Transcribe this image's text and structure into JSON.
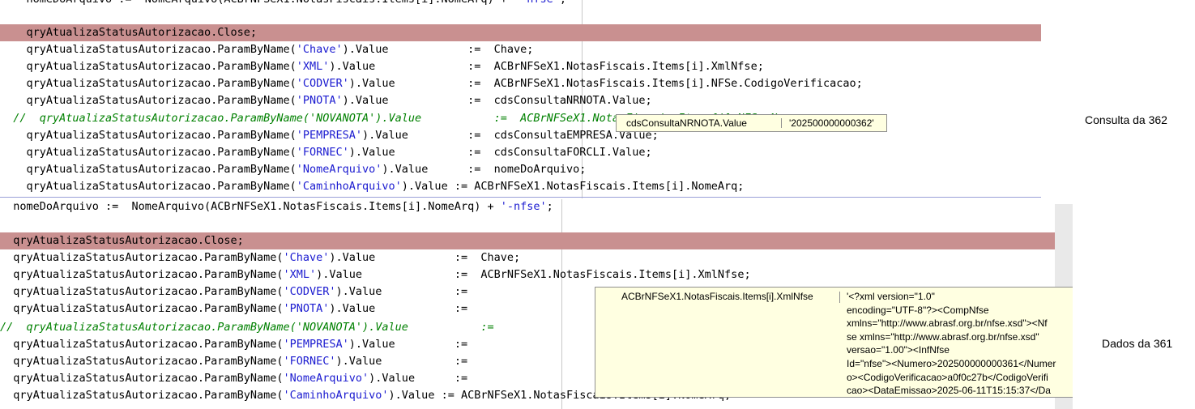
{
  "top_editor": {
    "lines": [
      [
        {
          "t": "    nomeDoArquivo :=  NomeArquivo(ACBrNFSeX1.NotasFiscais.Items[i].NomeArq) + "
        },
        {
          "t": "'-nfse'",
          "c": "str"
        },
        {
          "t": ";"
        }
      ],
      [],
      [
        {
          "t": "    qryAtualizaStatusAutorizacao.Close;"
        }
      ],
      [
        {
          "t": "    qryAtualizaStatusAutorizacao.ParamByName("
        },
        {
          "t": "'Chave'",
          "c": "str"
        },
        {
          "t": ").Value            :=  Chave;"
        }
      ],
      [
        {
          "t": "    qryAtualizaStatusAutorizacao.ParamByName("
        },
        {
          "t": "'XML'",
          "c": "str"
        },
        {
          "t": ").Value              :=  ACBrNFSeX1.NotasFiscais.Items[i].XmlNfse;"
        }
      ],
      [
        {
          "t": "    qryAtualizaStatusAutorizacao.ParamByName("
        },
        {
          "t": "'CODVER'",
          "c": "str"
        },
        {
          "t": ").Value           :=  ACBrNFSeX1.NotasFiscais.Items[i].NFSe.CodigoVerificacao;"
        }
      ],
      [
        {
          "t": "    qryAtualizaStatusAutorizacao.ParamByName("
        },
        {
          "t": "'PNOTA'",
          "c": "str"
        },
        {
          "t": ").Value            :=  cdsConsultaNRNOTA.Value;"
        }
      ],
      [
        {
          "t": "  //  qryAtualizaStatusAutorizacao.ParamByName('NOVANOTA').Value           :=  ACBrNFSeX1.NotasFiscais.Items[i].NFSe.Numero;",
          "c": "cm"
        }
      ],
      [
        {
          "t": "    qryAtualizaStatusAutorizacao.ParamByName("
        },
        {
          "t": "'PEMPRESA'",
          "c": "str"
        },
        {
          "t": ").Value         :=  cdsConsultaEMPRESA.Value;"
        }
      ],
      [
        {
          "t": "    qryAtualizaStatusAutorizacao.ParamByName("
        },
        {
          "t": "'FORNEC'",
          "c": "str"
        },
        {
          "t": ").Value           :=  cdsConsultaFORCLI.Value;"
        }
      ],
      [
        {
          "t": "    qryAtualizaStatusAutorizacao.ParamByName("
        },
        {
          "t": "'NomeArquivo'",
          "c": "str"
        },
        {
          "t": ").Value      :=  nomeDoArquivo;"
        }
      ],
      [
        {
          "t": "    qryAtualizaStatusAutorizacao.ParamByName("
        },
        {
          "t": "'CaminhoArquivo'",
          "c": "str"
        },
        {
          "t": ").Value := ACBrNFSeX1.NotasFiscais.Items[i].NomeArq;"
        }
      ]
    ]
  },
  "bottom_editor": {
    "lines": [
      [
        {
          "t": "  nomeDoArquivo :=  NomeArquivo(ACBrNFSeX1.NotasFiscais.Items[i].NomeArq) + "
        },
        {
          "t": "'-nfse'",
          "c": "str"
        },
        {
          "t": ";"
        }
      ],
      [],
      [
        {
          "t": "  qryAtualizaStatusAutorizacao.Close;"
        }
      ],
      [
        {
          "t": "  qryAtualizaStatusAutorizacao.ParamByName("
        },
        {
          "t": "'Chave'",
          "c": "str"
        },
        {
          "t": ").Value            :=  Chave;"
        }
      ],
      [
        {
          "t": "  qryAtualizaStatusAutorizacao.ParamByName("
        },
        {
          "t": "'XML'",
          "c": "str"
        },
        {
          "t": ").Value              :=  ACBrNFSeX1.NotasFiscais.Items[i].XmlNfse;"
        }
      ],
      [
        {
          "t": "  qryAtualizaStatusAutorizacao.ParamByName("
        },
        {
          "t": "'CODVER'",
          "c": "str"
        },
        {
          "t": ").Value           :="
        }
      ],
      [
        {
          "t": "  qryAtualizaStatusAutorizacao.ParamByName("
        },
        {
          "t": "'PNOTA'",
          "c": "str"
        },
        {
          "t": ").Value            :="
        }
      ],
      [
        {
          "t": "//  qryAtualizaStatusAutorizacao.ParamByName('NOVANOTA').Value           :=",
          "c": "cm"
        }
      ],
      [
        {
          "t": "  qryAtualizaStatusAutorizacao.ParamByName("
        },
        {
          "t": "'PEMPRESA'",
          "c": "str"
        },
        {
          "t": ").Value         :="
        }
      ],
      [
        {
          "t": "  qryAtualizaStatusAutorizacao.ParamByName("
        },
        {
          "t": "'FORNEC'",
          "c": "str"
        },
        {
          "t": ").Value           :="
        }
      ],
      [
        {
          "t": "  qryAtualizaStatusAutorizacao.ParamByName("
        },
        {
          "t": "'NomeArquivo'",
          "c": "str"
        },
        {
          "t": ").Value      :="
        }
      ],
      [
        {
          "t": "  qryAtualizaStatusAutorizacao.ParamByName("
        },
        {
          "t": "'CaminhoArquivo'",
          "c": "str"
        },
        {
          "t": ").Value := ACBrNFSeX1.NotasFiscais.Items[i].NomeArq;"
        }
      ]
    ]
  },
  "tooltip_nrnota": {
    "expression": "cdsConsultaNRNOTA.Value",
    "value": "'202500000000362'"
  },
  "tooltip_xml": {
    "expression": "ACBrNFSeX1.NotasFiscais.Items[i].XmlNfse",
    "value": "'<?xml version=\"1.0\"\nencoding=\"UTF-8\"?><CompNfse\nxmlns=\"http://www.abrasf.org.br/nfse.xsd\"><Nf\nse xmlns=\"http://www.abrasf.org.br/nfse.xsd\"\nversao=\"1.00\"><InfNfse\nId=\"nfse\"><Numero>202500000000361</Numer\no><CodigoVerificacao>a0f0c27b</CodigoVerifi\ncao><DataEmissao>2025-06-11T15:15:37</Da"
  },
  "labels": {
    "consulta": "Consulta da 362",
    "dados": "Dados da 361"
  },
  "colors": {
    "highlight_line": "#c99090",
    "comment": "#008000",
    "string": "#1b1bd0",
    "tooltip_bg": "#ffffe1"
  }
}
